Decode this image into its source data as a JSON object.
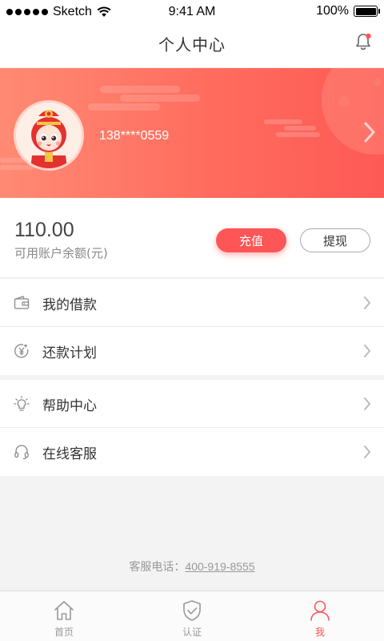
{
  "status_bar": {
    "carrier": "Sketch",
    "time": "9:41 AM",
    "battery": "100%"
  },
  "nav": {
    "title": "个人中心",
    "notification_icon": "bell-icon"
  },
  "profile": {
    "phone": "138****0559",
    "avatar_icon": "mascot-avatar",
    "arrow_icon": "chevron-right-icon"
  },
  "account": {
    "balance": "110.00",
    "balance_label": "可用账户余额(元)",
    "recharge_label": "充值",
    "withdraw_label": "提现"
  },
  "menu": {
    "group1": [
      {
        "label": "我的借款",
        "icon": "wallet-icon"
      },
      {
        "label": "还款计划",
        "icon": "yen-coin-icon"
      }
    ],
    "group2": [
      {
        "label": "帮助中心",
        "icon": "lightbulb-icon"
      },
      {
        "label": "在线客服",
        "icon": "headset-icon"
      }
    ]
  },
  "footer": {
    "hotline_label": "客服电话：",
    "hotline_number": "400-919-8555"
  },
  "tabbar": {
    "active": "me",
    "tabs": [
      {
        "label": "首页",
        "icon": "home-icon"
      },
      {
        "label": "认证",
        "icon": "shield-check-icon"
      },
      {
        "label": "我",
        "icon": "user-icon"
      }
    ]
  },
  "colors": {
    "accent": "#fe5556",
    "banner_start": "#ff8a74",
    "banner_end": "#fe5a55"
  }
}
